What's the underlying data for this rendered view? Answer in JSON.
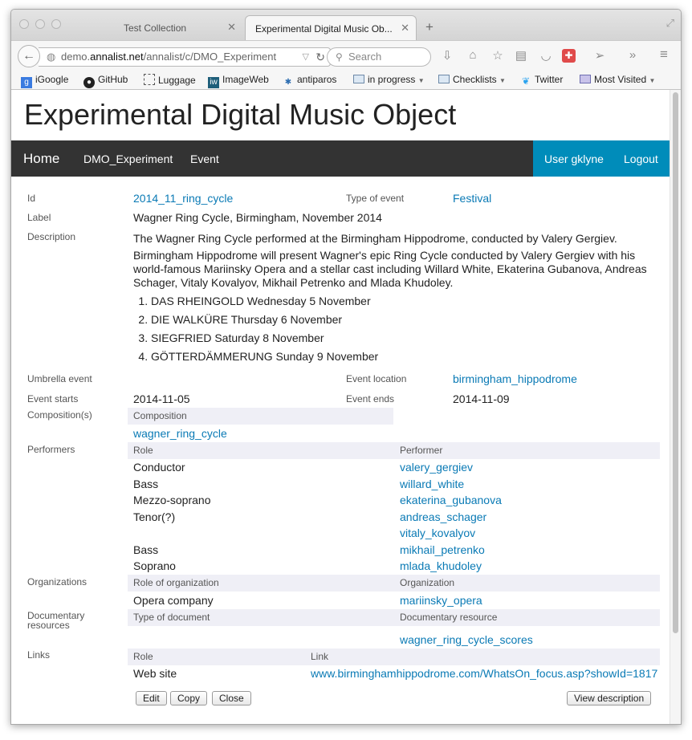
{
  "browser": {
    "tabs": [
      {
        "title": "Test Collection",
        "active": false
      },
      {
        "title": "Experimental Digital Music Ob...",
        "active": true
      }
    ],
    "url_prefix": "demo.",
    "url_host": "annalist.net",
    "url_path": "/annalist/c/DMO_Experiment",
    "search_placeholder": "Search",
    "bookmarks": [
      "iGoogle",
      "GitHub",
      "Luggage",
      "ImageWeb",
      "antiparos",
      "in progress",
      "Checklists",
      "Twitter",
      "Most Visited"
    ]
  },
  "page": {
    "title": "Experimental Digital Music Object",
    "nav": {
      "home": "Home",
      "collection": "DMO_Experiment",
      "type": "Event",
      "user": "User gklyne",
      "logout": "Logout"
    }
  },
  "fields": {
    "id_label": "Id",
    "id_value": "2014_11_ring_cycle",
    "type_label": "Type of event",
    "type_value": "Festival",
    "label_label": "Label",
    "label_value": "Wagner Ring Cycle, Birmingham, November 2014",
    "description_label": "Description",
    "description_p1": "The Wagner Ring Cycle performed at the Birmingham Hippodrome, conducted by Valery Gergiev.",
    "description_p2": "Birmingham Hippodrome will present Wagner's epic Ring Cycle conducted by Valery Gergiev with his world-famous Mariinsky Opera and a stellar cast including Willard White, Ekaterina Gubanova, Andreas Schager, Vitaly Kovalyov, Mikhail Petrenko and Mlada Khudoley.",
    "description_list": [
      "DAS RHEINGOLD Wednesday 5 November",
      "DIE WALKÜRE Thursday 6 November",
      "SIEGFRIED Saturday 8 November",
      "GÖTTERDÄMMERUNG Sunday 9 November"
    ],
    "umbrella_label": "Umbrella event",
    "location_label": "Event location",
    "location_value": "birmingham_hippodrome",
    "starts_label": "Event starts",
    "starts_value": "2014-11-05",
    "ends_label": "Event ends",
    "ends_value": "2014-11-09"
  },
  "compositions": {
    "label": "Composition(s)",
    "header": "Composition",
    "items": [
      "wagner_ring_cycle"
    ]
  },
  "performers": {
    "label": "Performers",
    "role_header": "Role",
    "performer_header": "Performer",
    "rows": [
      {
        "role": "Conductor",
        "performer": "valery_gergiev"
      },
      {
        "role": "Bass",
        "performer": "willard_white"
      },
      {
        "role": "Mezzo-soprano",
        "performer": "ekaterina_gubanova"
      },
      {
        "role": "Tenor(?)",
        "performer": "andreas_schager"
      },
      {
        "role": "",
        "performer": "vitaly_kovalyov"
      },
      {
        "role": "Bass",
        "performer": "mikhail_petrenko"
      },
      {
        "role": "Soprano",
        "performer": "mlada_khudoley"
      }
    ]
  },
  "organizations": {
    "label": "Organizations",
    "role_header": "Role of organization",
    "org_header": "Organization",
    "rows": [
      {
        "role": "Opera company",
        "organization": "mariinsky_opera"
      }
    ]
  },
  "documents": {
    "label": "Documentary resources",
    "type_header": "Type of document",
    "resource_header": "Documentary resource",
    "rows": [
      {
        "type": "",
        "resource": "wagner_ring_cycle_scores"
      }
    ]
  },
  "links": {
    "label": "Links",
    "role_header": "Role",
    "link_header": "Link",
    "rows": [
      {
        "role": "Web site",
        "link": "www.birminghamhippodrome.com/WhatsOn_focus.asp?showId=1817"
      }
    ]
  },
  "buttons": {
    "edit": "Edit",
    "copy": "Copy",
    "close": "Close",
    "view_description": "View description"
  },
  "colors": {
    "link": "#0a7ab5",
    "topbar": "#333333",
    "user_panel": "#008cba",
    "table_header": "#efeff6"
  }
}
